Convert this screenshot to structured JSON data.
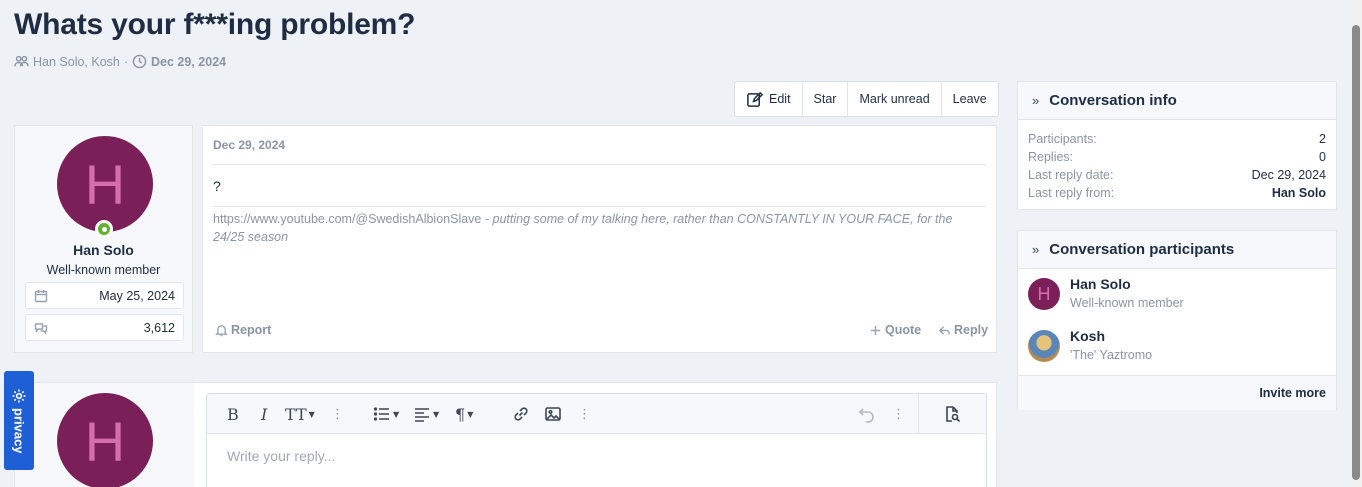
{
  "page": {
    "title": "Whats your f***ing problem?",
    "participants_text": "Han Solo, Kosh",
    "separator": "·",
    "date": "Dec 29, 2024"
  },
  "actions": {
    "edit": "Edit",
    "star": "Star",
    "mark_unread": "Mark unread",
    "leave": "Leave"
  },
  "message": {
    "author": {
      "initial": "H",
      "name": "Han Solo",
      "title": "Well-known member",
      "joined": "May 25, 2024",
      "messages": "3,612"
    },
    "date": "Dec 29, 2024",
    "body": "?",
    "signature_link": "https://www.youtube.com/@SwedishAlbionSlave",
    "signature_text": " - putting some of my talking here, rather than CONSTANTLY IN YOUR FACE, for the 24/25 season",
    "report": "Report",
    "quote": "Quote",
    "reply": "Reply"
  },
  "reply_box": {
    "avatar_initial": "H",
    "toolbar": {
      "bold": "B",
      "italic": "I",
      "text_size": "TT",
      "dots": "⋮",
      "paragraph": "¶"
    },
    "placeholder": "Write your reply..."
  },
  "conversation_info": {
    "heading": "Conversation info",
    "rows": [
      {
        "label": "Participants:",
        "value": "2"
      },
      {
        "label": "Replies:",
        "value": "0"
      },
      {
        "label": "Last reply date:",
        "value": "Dec 29, 2024"
      },
      {
        "label": "Last reply from:",
        "value": "Han Solo"
      }
    ]
  },
  "conversation_participants": {
    "heading": "Conversation participants",
    "people": [
      {
        "initial": "H",
        "name": "Han Solo",
        "title": "Well-known member"
      },
      {
        "initial": "",
        "name": "Kosh",
        "title": "'The' Yaztromo"
      }
    ],
    "invite": "Invite more"
  },
  "privacy": {
    "label": "privacy"
  },
  "colors": {
    "accent": "#1f5fd6",
    "avatar_bg": "#7a1f58",
    "online": "#63b02f"
  }
}
